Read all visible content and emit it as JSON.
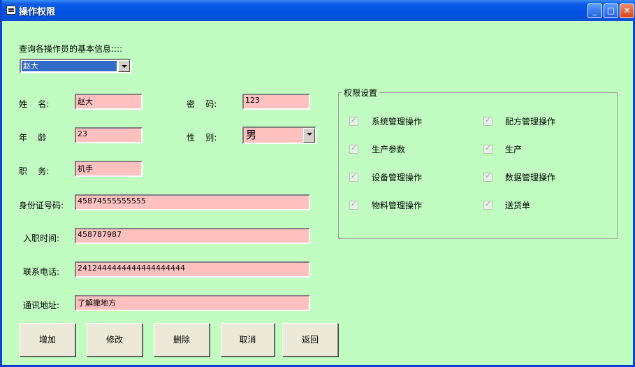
{
  "window": {
    "title": "操作权限"
  },
  "query_label": "查询各操作员的基本信息::::",
  "operator_select": {
    "value": "赵大"
  },
  "form": {
    "name_label": "姓    名:",
    "name_value": "赵大",
    "password_label": "密    码:",
    "password_value": "123",
    "age_label": "年    龄",
    "age_value": "23",
    "gender_label": "性    别:",
    "gender_value": "男",
    "position_label": "职    务:",
    "position_value": "机手",
    "id_label": "身份证号码:",
    "id_value": "45874555555555",
    "hire_label": "入职时间:",
    "hire_value": "458787987",
    "phone_label": "联系电话:",
    "phone_value": "2412444444444444444444",
    "address_label": "通讯地址:",
    "address_value": "了解撒地方"
  },
  "permissions": {
    "title": "权限设置",
    "items": [
      {
        "label": "系统管理操作",
        "checked": true
      },
      {
        "label": "配方管理操作",
        "checked": true
      },
      {
        "label": "生产参数",
        "checked": true
      },
      {
        "label": "生产",
        "checked": true
      },
      {
        "label": "设备管理操作",
        "checked": true
      },
      {
        "label": "数据管理操作",
        "checked": true
      },
      {
        "label": "物料管理操作",
        "checked": true
      },
      {
        "label": "送货单",
        "checked": true
      }
    ]
  },
  "buttons": {
    "add": "增加",
    "edit": "修改",
    "delete": "删除",
    "cancel": "取消",
    "back": "返回"
  }
}
